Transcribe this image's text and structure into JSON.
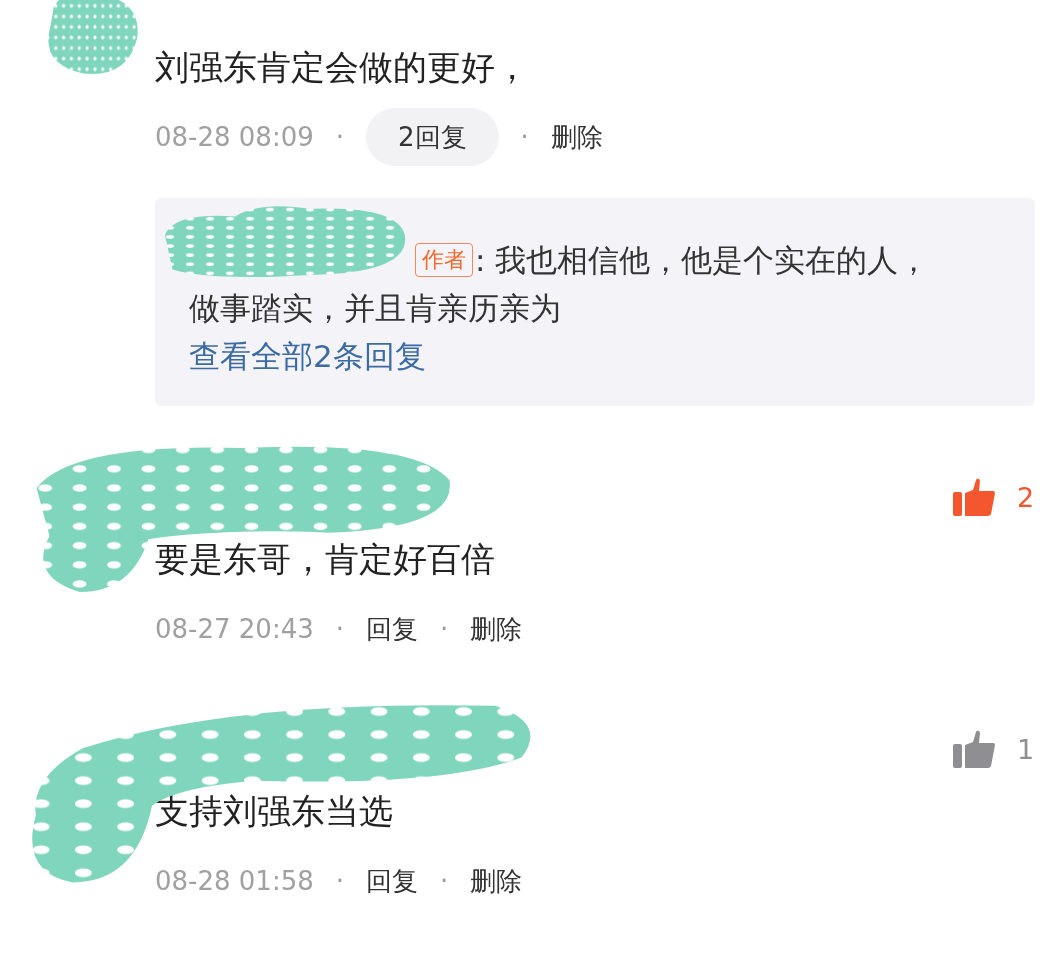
{
  "comments": [
    {
      "text": "刘强东肯定会做的更好，",
      "time": "08-28 08:09",
      "separators": [
        "·",
        "·"
      ],
      "reply": {
        "kind": "pill",
        "label": "2回复"
      },
      "delete": "删除",
      "replies": {
        "badge": "作者",
        "lines": [
          ": 我也相信他，他是个实在的人，",
          "做事踏实，并且肯亲历亲为"
        ],
        "more": "查看全部2条回复"
      }
    },
    {
      "like": {
        "selected": true,
        "count": "2"
      },
      "text": "要是东哥，肯定好百倍",
      "time": "08-27 20:43",
      "separators": [
        "·",
        "·"
      ],
      "reply": {
        "kind": "plain",
        "label": "回复"
      },
      "delete": "删除"
    },
    {
      "like": {
        "selected": false,
        "count": "1"
      },
      "text": "支持刘强东当选",
      "time": "08-28 01:58",
      "separators": [
        "·",
        "·"
      ],
      "reply": {
        "kind": "plain",
        "label": "回复"
      },
      "delete": "删除"
    }
  ]
}
